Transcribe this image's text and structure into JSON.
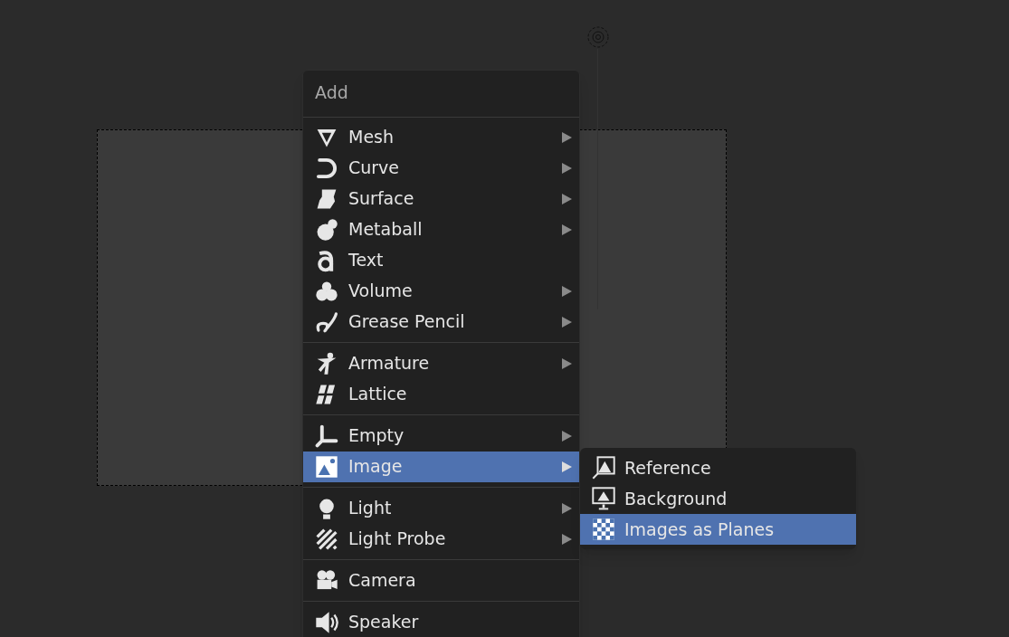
{
  "menu": {
    "title": "Add",
    "groups": [
      {
        "items": [
          {
            "label": "Mesh",
            "has_submenu": true,
            "selected": false
          },
          {
            "label": "Curve",
            "has_submenu": true,
            "selected": false
          },
          {
            "label": "Surface",
            "has_submenu": true,
            "selected": false
          },
          {
            "label": "Metaball",
            "has_submenu": true,
            "selected": false
          },
          {
            "label": "Text",
            "has_submenu": false,
            "selected": false
          },
          {
            "label": "Volume",
            "has_submenu": true,
            "selected": false
          },
          {
            "label": "Grease Pencil",
            "has_submenu": true,
            "selected": false
          }
        ]
      },
      {
        "items": [
          {
            "label": "Armature",
            "has_submenu": true,
            "selected": false
          },
          {
            "label": "Lattice",
            "has_submenu": false,
            "selected": false
          }
        ]
      },
      {
        "items": [
          {
            "label": "Empty",
            "has_submenu": true,
            "selected": false
          },
          {
            "label": "Image",
            "has_submenu": true,
            "selected": true
          }
        ]
      },
      {
        "items": [
          {
            "label": "Light",
            "has_submenu": true,
            "selected": false
          },
          {
            "label": "Light Probe",
            "has_submenu": true,
            "selected": false
          }
        ]
      },
      {
        "items": [
          {
            "label": "Camera",
            "has_submenu": false,
            "selected": false
          }
        ]
      },
      {
        "items": [
          {
            "label": "Speaker",
            "has_submenu": false,
            "selected": false
          }
        ]
      }
    ]
  },
  "submenu": {
    "items": [
      {
        "label": "Reference",
        "selected": false
      },
      {
        "label": "Background",
        "selected": false
      },
      {
        "label": "Images as Planes",
        "selected": true
      }
    ]
  }
}
